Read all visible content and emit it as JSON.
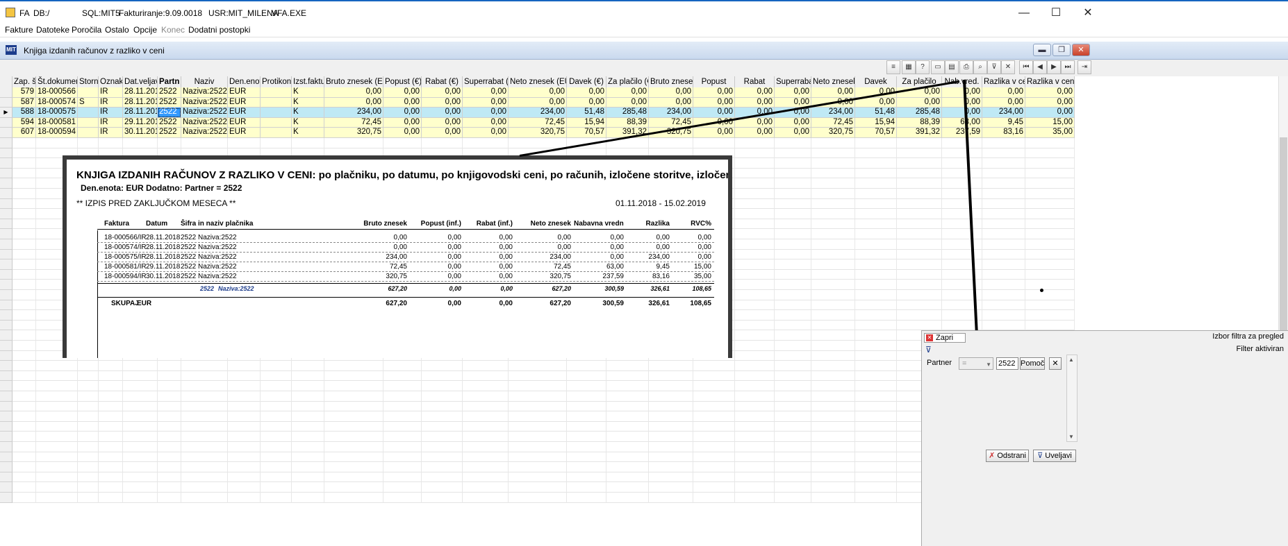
{
  "titlebar": {
    "app": "FA",
    "db": "DB:/",
    "sql": "SQL:MIT5",
    "fakturiranje": "Fakturiranje:9.09.0018",
    "user": "USR:MIT_MILENA",
    "exe": "VFA.EXE",
    "minimize": "—",
    "maximize": "☐",
    "close": "✕"
  },
  "menu": [
    "Fakture",
    "Datoteke",
    "Poročila",
    "Ostalo",
    "Opcije",
    "Konec",
    "Dodatni postopki"
  ],
  "window": {
    "title": "Knjiga izdanih računov z razliko v ceni",
    "min": "▬",
    "restore": "❐",
    "close": "✕"
  },
  "toolbar": {
    "icons": [
      "list-icon",
      "table-icon",
      "help-icon",
      "doc-icon",
      "folder-icon",
      "print-icon",
      "zoom-icon",
      "funnel-icon",
      "cross-icon",
      "first-icon",
      "prev-icon",
      "next-icon",
      "last-icon",
      "exit-icon"
    ],
    "glyphs": [
      "≡",
      "▦",
      "?",
      "▭",
      "▤",
      "⎙",
      "⌕",
      "⊽",
      "✕",
      "⏮",
      "◀",
      "▶",
      "⏭",
      "⇥"
    ]
  },
  "grid": {
    "columns": [
      "Zap. št.",
      "Št.dokumenta",
      "Storno",
      "Oznaka",
      "Dat.veljave",
      "Partn",
      "Naziv",
      "Den.enota",
      "Protikonto",
      "Izst.fakture",
      "Bruto znesek (EUR)",
      "Popust (€)",
      "Rabat (€)",
      "Superrabat (€)",
      "Neto znesek (EUR)",
      "Davek (€)",
      "Za plačilo (€)",
      "Bruto znesek",
      "Popust",
      "Rabat",
      "Superrabat",
      "Neto znesek",
      "Davek",
      "Za plačilo",
      "Nab.vred.",
      "Razlika v ceni",
      "Razlika v ceni %"
    ],
    "sort_marker": "▲",
    "row_indicator": "▶",
    "rows": [
      [
        "579",
        "18-000566",
        "",
        "IR",
        "28.11.2018",
        "2522",
        "Naziva:2522",
        "EUR",
        "",
        "K",
        "0,00",
        "0,00",
        "0,00",
        "0,00",
        "0,00",
        "0,00",
        "0,00",
        "0,00",
        "0,00",
        "0,00",
        "0,00",
        "0,00",
        "0,00",
        "0,00",
        "0,00",
        "0,00",
        "0,00"
      ],
      [
        "587",
        "18-000574",
        "S",
        "IR",
        "28.11.2018",
        "2522",
        "Naziva:2522",
        "EUR",
        "",
        "K",
        "0,00",
        "0,00",
        "0,00",
        "0,00",
        "0,00",
        "0,00",
        "0,00",
        "0,00",
        "0,00",
        "0,00",
        "0,00",
        "0,00",
        "0,00",
        "0,00",
        "0,00",
        "0,00",
        "0,00"
      ],
      [
        "588",
        "18-000575",
        "",
        "IR",
        "28.11.2018",
        "2522",
        "Naziva:2522",
        "EUR",
        "",
        "K",
        "234,00",
        "0,00",
        "0,00",
        "0,00",
        "234,00",
        "51,48",
        "285,48",
        "234,00",
        "0,00",
        "0,00",
        "0,00",
        "234,00",
        "51,48",
        "285,48",
        "0,00",
        "234,00",
        "0,00"
      ],
      [
        "594",
        "18-000581",
        "",
        "IR",
        "29.11.2018",
        "2522",
        "Naziva:2522",
        "EUR",
        "",
        "K",
        "72,45",
        "0,00",
        "0,00",
        "0,00",
        "72,45",
        "15,94",
        "88,39",
        "72,45",
        "0,00",
        "0,00",
        "0,00",
        "72,45",
        "15,94",
        "88,39",
        "63,00",
        "9,45",
        "15,00"
      ],
      [
        "607",
        "18-000594",
        "",
        "IR",
        "30.11.2018",
        "2522",
        "Naziva:2522",
        "EUR",
        "",
        "K",
        "320,75",
        "0,00",
        "0,00",
        "0,00",
        "320,75",
        "70,57",
        "391,32",
        "320,75",
        "0,00",
        "0,00",
        "0,00",
        "320,75",
        "70,57",
        "391,32",
        "237,59",
        "83,16",
        "35,00"
      ]
    ],
    "selected_row": 2
  },
  "report": {
    "title": "KNJIGA IZDANIH RAČUNOV Z RAZLIKO V CENI: po plačniku, po datumu, po knjigovodski ceni, po računih, izločene storitve, izločeni artikli",
    "subtitle": "Den.enota: EUR  Dodatno:  Partner = 2522",
    "note": "** IZPIS PRED ZAKLJUČKOM MESECA **",
    "dates": "01.11.2018   -  15.02.2019",
    "headers": [
      "Faktura",
      "Datum",
      "Šifra in naziv  plačnika",
      "Bruto znesek",
      "Popust (inf.)",
      "Rabat (inf.)",
      "Neto znesek",
      "Nabavna vrednost",
      "Razlika",
      "RVC%"
    ],
    "rows": [
      [
        "18-000566/IR",
        "28.11.2018",
        "2522   Naziva:2522",
        "0,00",
        "0,00",
        "0,00",
        "0,00",
        "0,00",
        "0,00",
        "0,00"
      ],
      [
        "18-000574/IR",
        "28.11.2018",
        "2522   Naziva:2522",
        "0,00",
        "0,00",
        "0,00",
        "0,00",
        "0,00",
        "0,00",
        "0,00"
      ],
      [
        "18-000575/IR",
        "28.11.2018",
        "2522   Naziva:2522",
        "234,00",
        "0,00",
        "0,00",
        "234,00",
        "0,00",
        "234,00",
        "0,00"
      ],
      [
        "18-000581/IR",
        "29.11.2018",
        "2522   Naziva:2522",
        "72,45",
        "0,00",
        "0,00",
        "72,45",
        "63,00",
        "9,45",
        "15,00"
      ],
      [
        "18-000594/IR",
        "30.11.2018",
        "2522   Naziva:2522",
        "320,75",
        "0,00",
        "0,00",
        "320,75",
        "237,59",
        "83,16",
        "35,00"
      ]
    ],
    "subtotal": {
      "code": "2522",
      "name": "Naziva:2522",
      "values": [
        "627,20",
        "0,00",
        "0,00",
        "627,20",
        "300,59",
        "326,61",
        "108,65"
      ]
    },
    "total": {
      "label": "SKUPAJ",
      "currency": "EUR",
      "values": [
        "627,20",
        "0,00",
        "0,00",
        "627,20",
        "300,59",
        "326,61",
        "108,65"
      ]
    }
  },
  "filter": {
    "close_label": "Zapri",
    "title": "Izbor filtra za pregled",
    "status": "Filter aktiviran",
    "field_label": "Partner",
    "operator": "=",
    "value": "2522",
    "pick_label": "Pomoč",
    "clear_glyph": "✕",
    "remove_label": "Odstrani",
    "apply_label": "Uveljavi",
    "scroll_up": "▲",
    "scroll_down": "▼"
  }
}
